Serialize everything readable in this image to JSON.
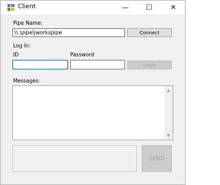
{
  "window": {
    "title": "Client"
  },
  "titlebar": {
    "minimize": "—",
    "maximize": "☐",
    "close": "✕"
  },
  "pipe": {
    "label": "Pipe Name:",
    "value": "\\\\.\\pipe\\jworkspipe",
    "connect_label": "Connect"
  },
  "login": {
    "label": "Log In:",
    "id_label": "ID",
    "id_value": "",
    "password_label": "Password",
    "password_value": "",
    "login_label": "Login"
  },
  "messages": {
    "label": "Messages:"
  },
  "send": {
    "value": "",
    "send_label": "SEND"
  }
}
